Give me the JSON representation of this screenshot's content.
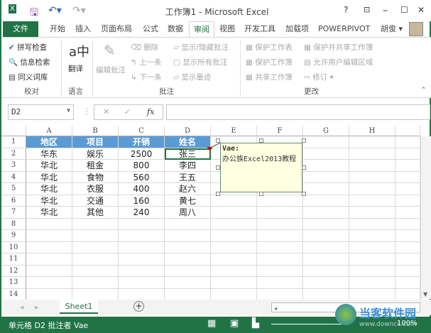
{
  "window": {
    "title": "工作簿1 - Microsoft Excel",
    "help": "?",
    "minimize": "–",
    "maximize": "☐",
    "close": "✕"
  },
  "tabs": [
    "文件",
    "开始",
    "插入",
    "页面布局",
    "公式",
    "数据",
    "审阅",
    "视图",
    "开发工具",
    "加载项",
    "POWERPIVOT"
  ],
  "user": "胡俊 ▾",
  "ribbon": {
    "proof": {
      "items": [
        "拼写检查",
        "信息检索",
        "同义词库"
      ],
      "label": "校对"
    },
    "lang": {
      "item": "翻译",
      "label": "语言"
    },
    "comments": {
      "edit": "编辑批注",
      "delete": "删除",
      "prev": "上一条",
      "next": "下一条",
      "show_hide": "显示/隐藏批注",
      "show_all": "显示所有批注",
      "show_ink": "显示墨迹",
      "label": "批注"
    },
    "changes": {
      "protect_sheet": "保护工作表",
      "protect_wb": "保护工作簿",
      "share_wb": "共享工作簿",
      "protect_share": "保护并共享工作簿",
      "allow_edit": "允许用户编辑区域",
      "track": "修订 ▾",
      "label": "更改"
    }
  },
  "formula_bar": {
    "name_box": "D2",
    "cancel": "✕",
    "enter": "✓",
    "fx": "fx",
    "value": ""
  },
  "columns": [
    "A",
    "B",
    "C",
    "D",
    "E",
    "F",
    "G",
    "H"
  ],
  "rows": [
    "1",
    "2",
    "3",
    "4",
    "5",
    "6",
    "7",
    "8",
    "9",
    "10",
    "11",
    "12",
    "13",
    "14"
  ],
  "table": {
    "header": [
      "地区",
      "项目",
      "开销",
      "姓名"
    ],
    "data": [
      [
        "华东",
        "娱乐",
        "2500",
        "张三"
      ],
      [
        "华北",
        "租金",
        "800",
        "李四"
      ],
      [
        "华北",
        "食物",
        "560",
        "王五"
      ],
      [
        "华北",
        "衣服",
        "400",
        "赵六"
      ],
      [
        "华北",
        "交通",
        "160",
        "黄七"
      ],
      [
        "华北",
        "其他",
        "240",
        "周八"
      ]
    ]
  },
  "comment": {
    "author": "Vae:",
    "text": "办公族Excel2013教程"
  },
  "sheets": [
    "Sheet1"
  ],
  "status": {
    "text": "单元格 D2 批注者 Vae",
    "zoom": "100%"
  },
  "watermark": {
    "brand": "当客软件园",
    "url": "www.downcc.com"
  },
  "colors": {
    "accent": "#217346",
    "header_fill": "#5b9bd5"
  }
}
